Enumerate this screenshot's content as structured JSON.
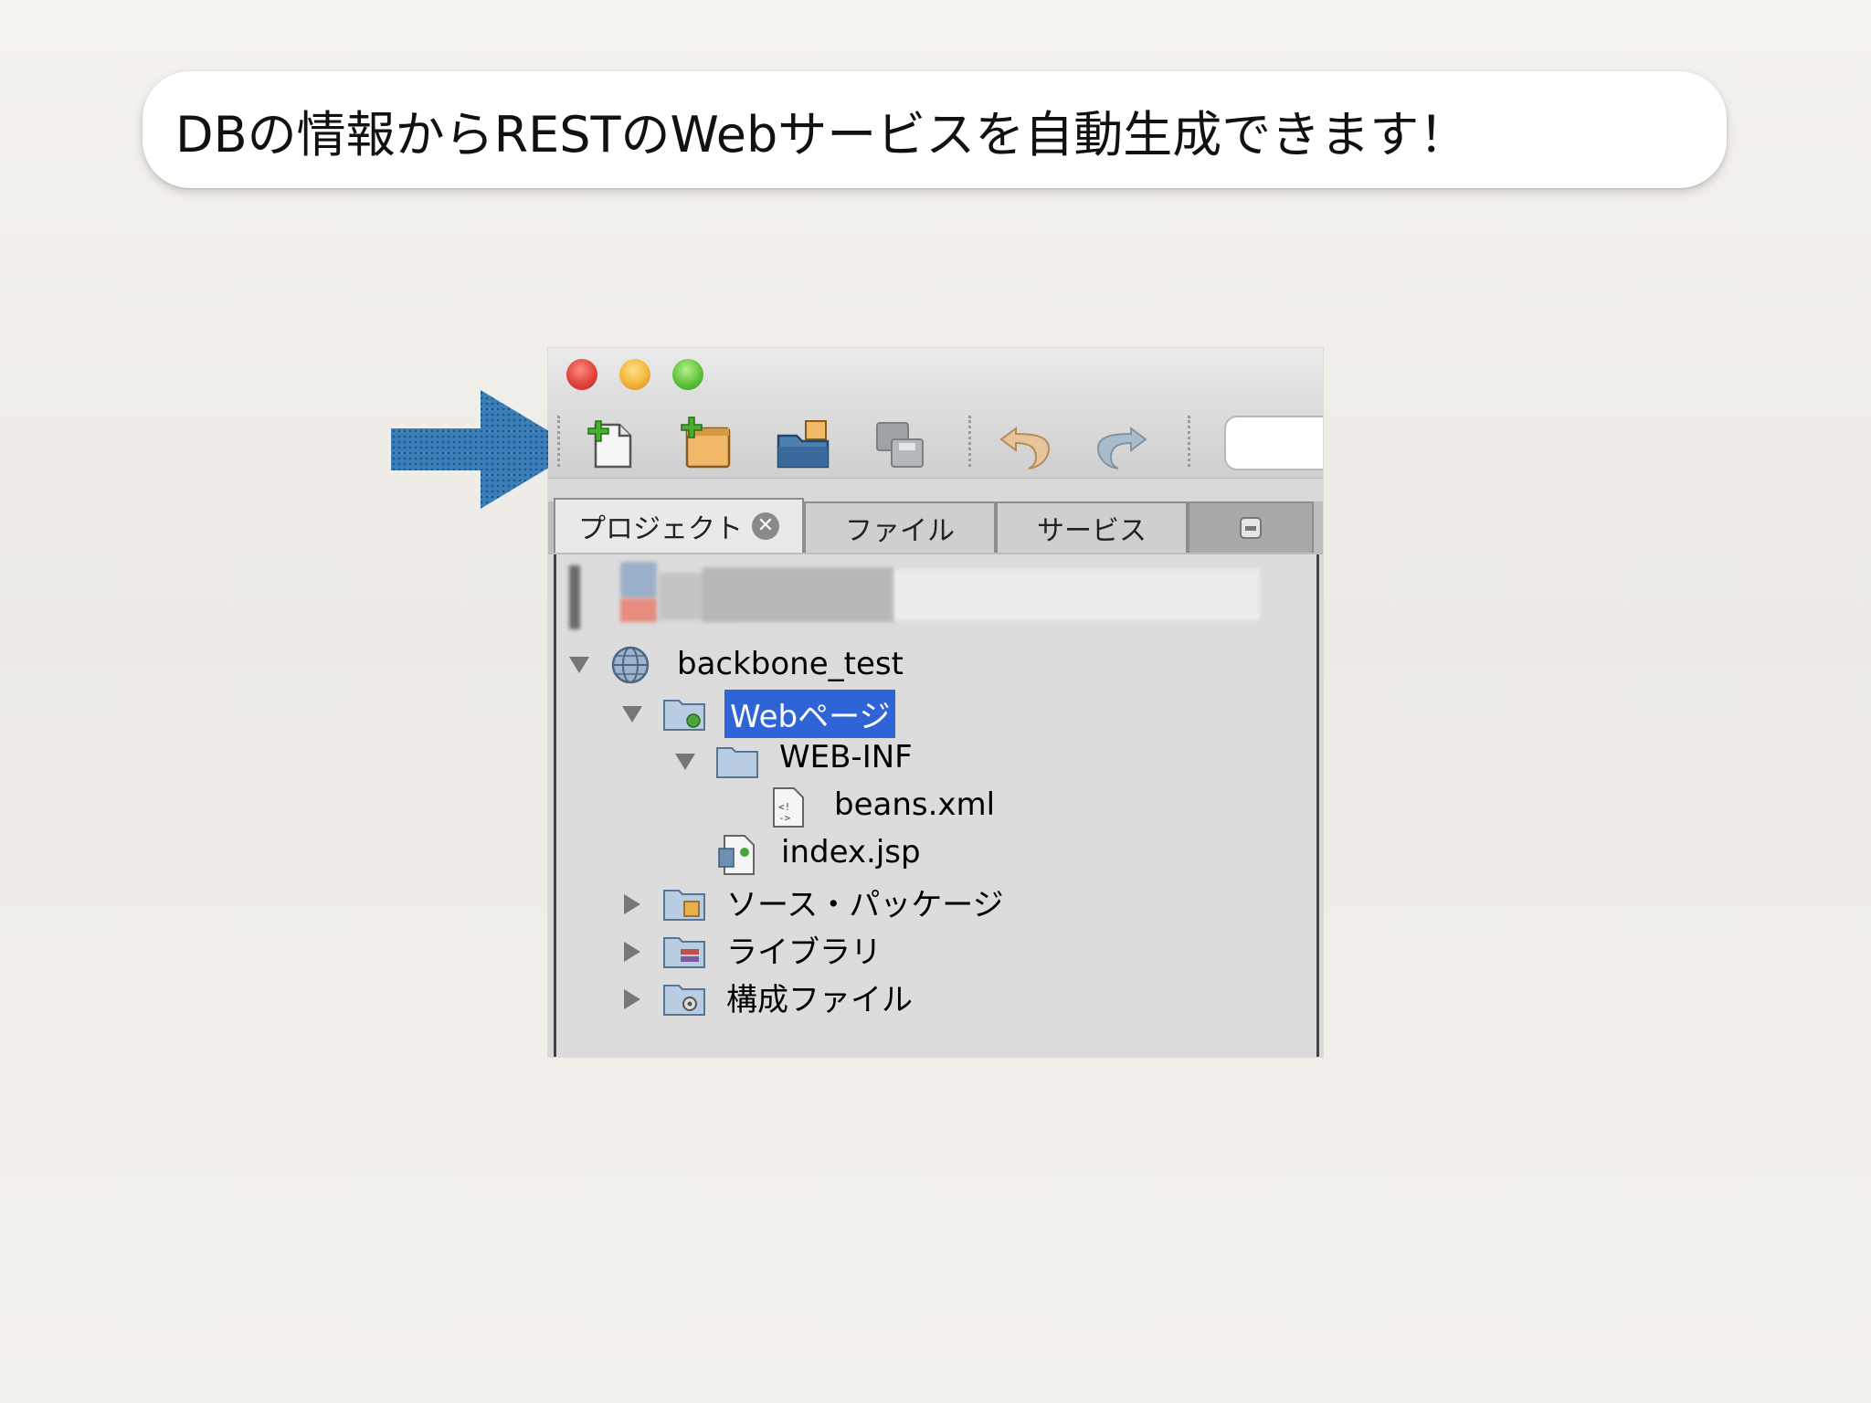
{
  "callout": {
    "text": "DBの情報からRESTのWebサービスを自動生成できます！"
  },
  "window": {
    "toolbar": {
      "icons": [
        "new-file-icon",
        "new-project-icon",
        "open-project-icon",
        "save-all-icon",
        "undo-icon",
        "redo-icon"
      ]
    },
    "tabs": [
      {
        "label": "プロジェクト",
        "active": true
      },
      {
        "label": "ファイル",
        "active": false
      },
      {
        "label": "サービス",
        "active": false
      }
    ],
    "tree": {
      "project": "backbone_test",
      "web_pages": "Webページ",
      "web_inf": "WEB-INF",
      "beans": "beans.xml",
      "index": "index.jsp",
      "source_packages": "ソース・パッケージ",
      "libraries": "ライブラリ",
      "config_files": "構成ファイル"
    }
  },
  "colors": {
    "selection": "#2f64d6",
    "arrow": "#3b7fb8",
    "close_red": "#e0443b",
    "minimize_yellow": "#f2b53a",
    "zoom_green": "#5fc33c"
  }
}
